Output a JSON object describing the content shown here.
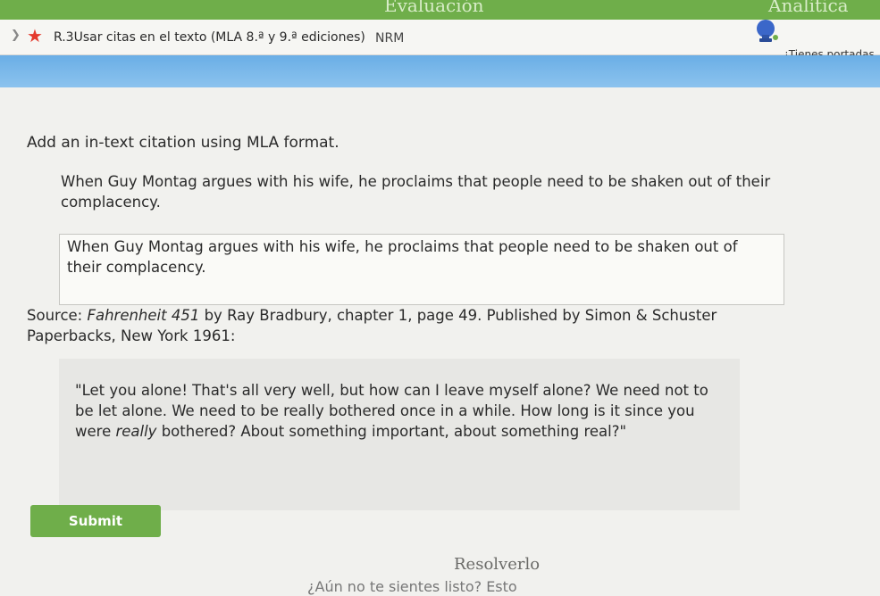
{
  "top_nav": {
    "items": [
      "Evaluación",
      "Analítica"
    ]
  },
  "header": {
    "skill_title": "R.3Usar citas en el texto (MLA 8.ª y 9.ª ediciones)",
    "skill_code": "NRM",
    "prompt_text": "¡Tienes portadas"
  },
  "question": {
    "instruction": "Add an in-text citation using MLA format.",
    "sentence": "When Guy Montag argues with his wife, he proclaims that people need to be shaken out of their complacency.",
    "answer_value": "When Guy Montag argues with his wife, he proclaims that people need to be shaken out of their complacency.",
    "source_label": "Source: ",
    "source_title": "Fahrenheit 451",
    "source_rest": " by Ray Bradbury, chapter 1, page 49. Published by Simon & Schuster Paperbacks, New York 1961:",
    "quote_part1": "\"Let you alone! That's all very well, but how can I leave myself alone? We need not to be let alone. We need to be really bothered once in a while. How long is it since you were ",
    "quote_emphasis": "really",
    "quote_part2": " bothered? About something important, about something real?\""
  },
  "actions": {
    "submit_label": "Submit",
    "resolve_label": "Resolverlo",
    "ready_text": "¿Aún no te sientes listo? Esto"
  },
  "colors": {
    "nav_green": "#6fae4a",
    "band_blue": "#6aaee6",
    "star_red": "#e43a2d"
  }
}
